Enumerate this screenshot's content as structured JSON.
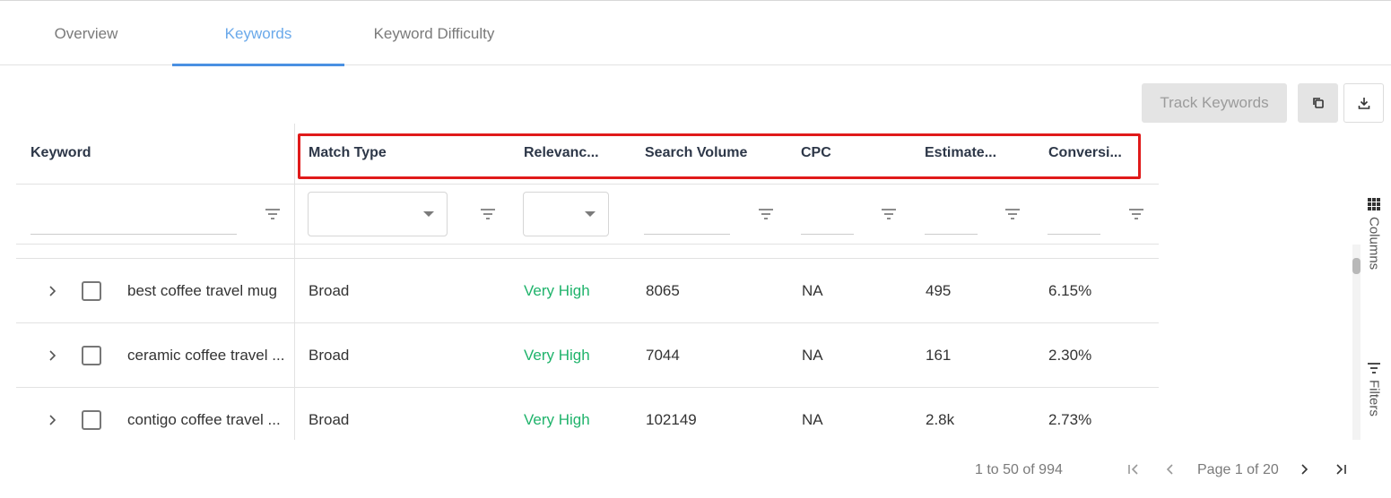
{
  "tabs": [
    {
      "label": "Overview",
      "active": false
    },
    {
      "label": "Keywords",
      "active": true
    },
    {
      "label": "Keyword Difficulty",
      "active": false
    }
  ],
  "toolbar": {
    "track_keywords_label": "Track Keywords",
    "copy_icon": "copy-icon",
    "download_icon": "download-icon"
  },
  "table": {
    "columns": [
      "Keyword",
      "Match Type",
      "Relevanc...",
      "Search Volume",
      "CPC",
      "Estimate...",
      "Conversi..."
    ],
    "rows": [
      {
        "keyword": "best coffee travel mug",
        "match_type": "Broad",
        "relevance": "Very High",
        "search_volume": "8065",
        "cpc": "NA",
        "estimate": "495",
        "conversion": "6.15%"
      },
      {
        "keyword": "ceramic coffee travel ...",
        "match_type": "Broad",
        "relevance": "Very High",
        "search_volume": "7044",
        "cpc": "NA",
        "estimate": "161",
        "conversion": "2.30%"
      },
      {
        "keyword": "contigo coffee travel ...",
        "match_type": "Broad",
        "relevance": "Very High",
        "search_volume": "102149",
        "cpc": "NA",
        "estimate": "2.8k",
        "conversion": "2.73%"
      }
    ]
  },
  "side_panel": {
    "columns_label": "Columns",
    "filters_label": "Filters"
  },
  "pagination": {
    "range_text": "1 to 50 of 994",
    "page_text": "Page 1 of 20"
  },
  "colors": {
    "accent": "#4a90e2",
    "relevance_green": "#1fb36b"
  }
}
